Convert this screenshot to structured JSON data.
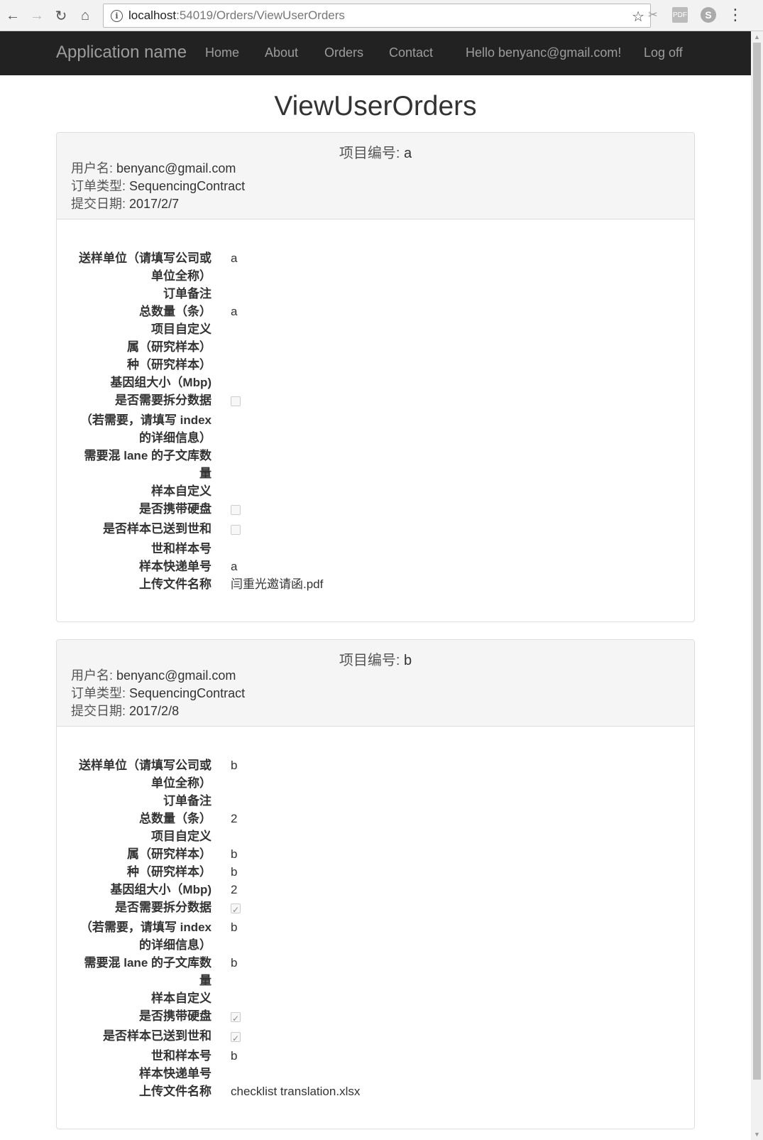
{
  "browser": {
    "url_host": "localhost",
    "url_rest": ":54019/Orders/ViewUserOrders"
  },
  "navbar": {
    "brand": "Application name",
    "links": [
      "Home",
      "About",
      "Orders",
      "Contact"
    ],
    "greeting": "Hello benyanc@gmail.com!",
    "logoff": "Log off"
  },
  "page_title": "ViewUserOrders",
  "labels": {
    "project_no": "项目编号: ",
    "username": "用户名: ",
    "order_type": "订单类型: ",
    "submit_date": "提交日期: ",
    "fields": [
      "送样单位（请填写公司或",
      "单位全称）",
      "订单备注",
      "总数量（条）",
      "项目自定义",
      "属（研究样本）",
      "种（研究样本）",
      "基因组大小（Mbp)",
      "是否需要拆分数据",
      "（若需要，请填写 index",
      "的详细信息）",
      "需要混 lane 的子文库数",
      "量",
      "样本自定义",
      "是否携带硬盘",
      "是否样本已送到世和",
      "世和样本号",
      "样本快递单号",
      "上传文件名称"
    ]
  },
  "orders": [
    {
      "project_no": "a",
      "username": "benyanc@gmail.com",
      "order_type": "SequencingContract",
      "submit_date": "2017/2/7",
      "unit": "a",
      "remark": "",
      "total": "a",
      "project_custom": "",
      "genus": "",
      "species": "",
      "genome_size": "",
      "split_data": false,
      "index_info": "",
      "mixed_lane": "",
      "sample_custom": "",
      "hard_disk": false,
      "sample_sent": false,
      "sample_no": "",
      "express_no": "a",
      "file_name": "闫重光邀请函.pdf"
    },
    {
      "project_no": "b",
      "username": "benyanc@gmail.com",
      "order_type": "SequencingContract",
      "submit_date": "2017/2/8",
      "unit": "b",
      "remark": "",
      "total": "2",
      "project_custom": "",
      "genus": "b",
      "species": "b",
      "genome_size": "2",
      "split_data": true,
      "index_info": "b",
      "mixed_lane": "b",
      "sample_custom": "",
      "hard_disk": true,
      "sample_sent": true,
      "sample_no": "b",
      "express_no": "",
      "file_name": "checklist translation.xlsx"
    }
  ]
}
